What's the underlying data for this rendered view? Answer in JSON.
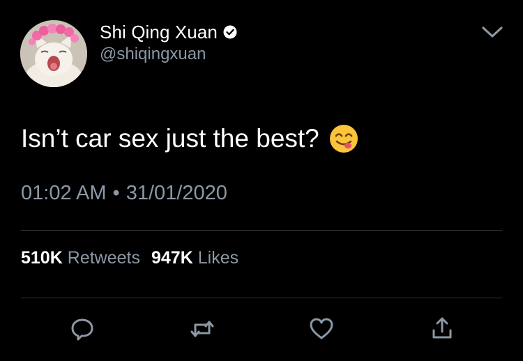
{
  "user": {
    "display_name": "Shi Qing Xuan",
    "handle": "@shiqingxuan",
    "verified_icon": "verified-badge-icon",
    "avatar": "cat-with-flower-crown-avatar"
  },
  "tweet": {
    "text": "Isn’t car sex just the best?",
    "emoji": "face-savoring-food-emoji",
    "time": "01:02 AM",
    "separator": "•",
    "date": "31/01/2020"
  },
  "stats": {
    "retweets_count": "510K",
    "retweets_label": "Retweets",
    "likes_count": "947K",
    "likes_label": "Likes"
  },
  "actions": [
    "reply-icon",
    "retweet-icon",
    "like-icon",
    "share-icon"
  ],
  "colors": {
    "background": "#000000",
    "text": "#ffffff",
    "secondary": "#8b98a5",
    "divider": "#2f3336",
    "icon": "#8b98a5"
  }
}
